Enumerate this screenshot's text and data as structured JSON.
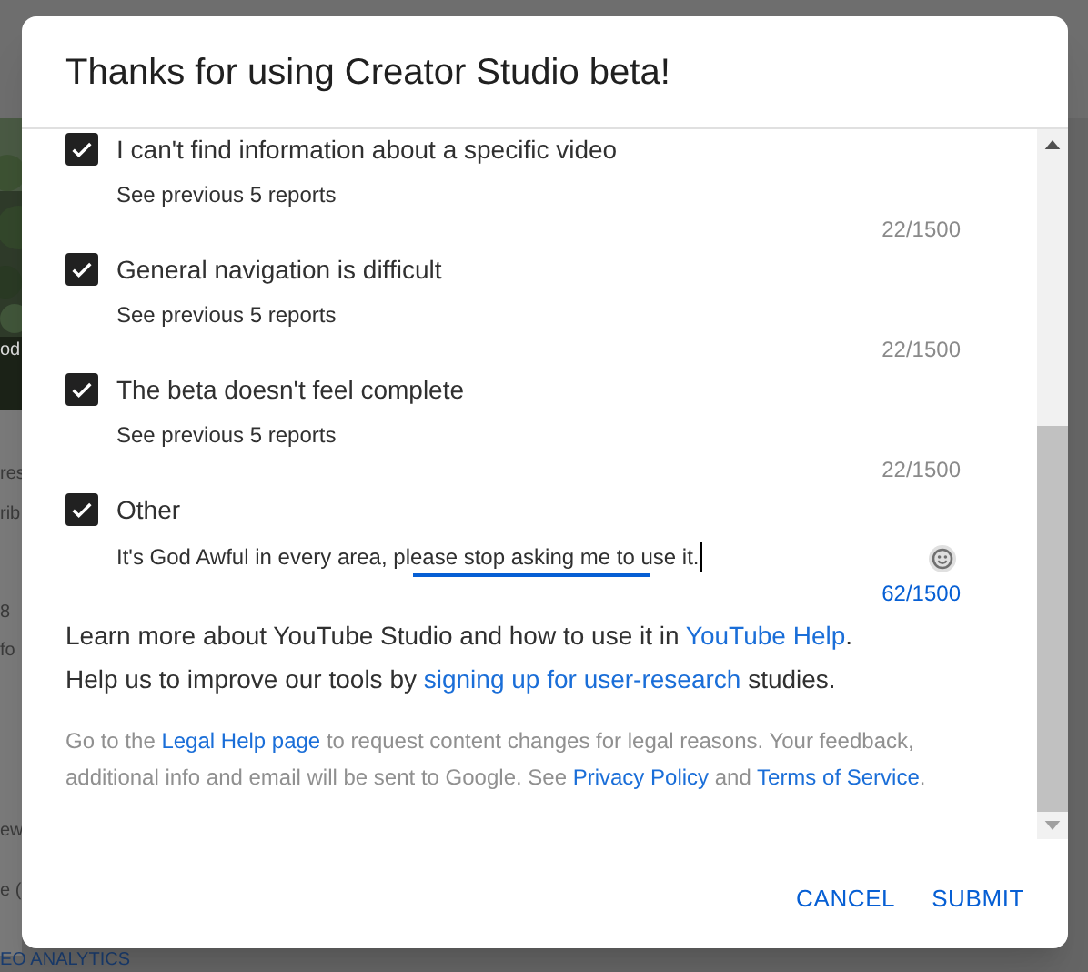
{
  "background": {
    "fragments": [
      {
        "text": "od",
        "on_picture": true
      },
      {
        "text": "res",
        "on_picture": false
      },
      {
        "text": "rib",
        "on_picture": false
      },
      {
        "text": "8",
        "on_picture": false
      },
      {
        "text": "fo",
        "on_picture": false
      },
      {
        "text": "ew",
        "on_picture": false
      },
      {
        "text": "e (",
        "on_picture": false
      }
    ],
    "bottom_label": "EO ANALYTICS"
  },
  "dialog": {
    "title": "Thanks for using Creator Studio beta!",
    "items": [
      {
        "kind": "reports",
        "label": "I can't find information about a specific video",
        "checked": true,
        "note": "See previous 5 reports",
        "counter": "22/1500"
      },
      {
        "kind": "reports",
        "label": "General navigation is difficult",
        "checked": true,
        "note": "See previous 5 reports",
        "counter": "22/1500"
      },
      {
        "kind": "reports",
        "label": "The beta doesn't feel complete",
        "checked": true,
        "note": "See previous 5 reports",
        "counter": "22/1500"
      },
      {
        "kind": "text",
        "label": "Other",
        "checked": true,
        "value": "It's God Awful in every area, please stop asking me to use it.",
        "focused": true,
        "counter": "62/1500"
      }
    ],
    "paragraphs": [
      {
        "kind": "body",
        "parts": [
          {
            "text": "Learn more about YouTube Studio and how to use it in ",
            "link": false
          },
          {
            "text": "YouTube Help",
            "link": true
          },
          {
            "text": ".",
            "link": false
          }
        ]
      },
      {
        "kind": "body",
        "parts": [
          {
            "text": "Help us to improve our tools by ",
            "link": false
          },
          {
            "text": "signing up for user-research",
            "link": true
          },
          {
            "text": " studies.",
            "link": false
          }
        ]
      },
      {
        "kind": "legal",
        "parts": [
          {
            "text": "Go to the ",
            "link": false
          },
          {
            "text": "Legal Help page",
            "link": true
          },
          {
            "text": " to request content changes for legal reasons. Your feedback, additional info and email will be sent to Google. See ",
            "link": false
          },
          {
            "text": "Privacy Policy",
            "link": true
          },
          {
            "text": " and ",
            "link": false
          },
          {
            "text": "Terms of Service",
            "link": true
          },
          {
            "text": ".",
            "link": false
          }
        ]
      }
    ],
    "buttons": [
      "CANCEL",
      "SUBMIT"
    ]
  }
}
